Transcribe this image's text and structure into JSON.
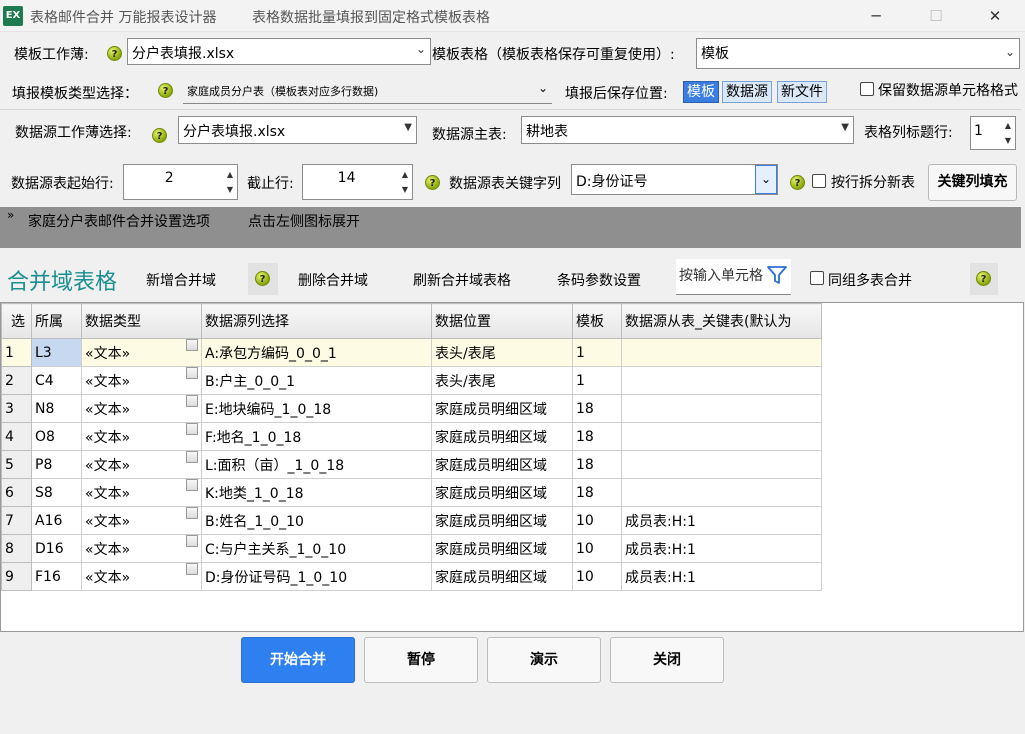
{
  "window": {
    "app_icon": "EX",
    "title": "表格邮件合并 万能报表设计器",
    "subtitle": "表格数据批量填报到固定格式模板表格",
    "minimize": "─",
    "maximize": "☐",
    "close": "✕"
  },
  "row1": {
    "template_workbook_label": "模板工作薄:",
    "template_workbook_value": "分户表填报.xlsx",
    "template_sheet_label": "模板表格（模板表格保存可重复使用）:",
    "template_sheet_value": "模板"
  },
  "row2": {
    "fill_type_label": "填报模板类型选择：",
    "fill_type_value": "家庭成员分户表（模板表对应多行数据)",
    "save_location_label": "填报后保存位置:",
    "save_options": [
      "模板",
      "数据源",
      "新文件"
    ],
    "keep_format_label": "保留数据源单元格格式"
  },
  "row3": {
    "source_workbook_label": "数据源工作薄选择:",
    "source_workbook_value": "分户表填报.xlsx",
    "source_main_label": "数据源主表:",
    "source_main_value": "耕地表",
    "header_row_label": "表格列标题行:",
    "header_row_value": "1"
  },
  "row4": {
    "start_row_label": "数据源表起始行:",
    "start_row_value": "2",
    "end_row_label": "截止行:",
    "end_row_value": "14",
    "key_column_label": "数据源表关键字列",
    "key_column_value": "D:身份证号",
    "split_label": "按行拆分新表",
    "key_fill_button": "关键列填充"
  },
  "strip": {
    "expand_icon": "»",
    "title": "家庭分户表邮件合并设置选项",
    "hint": "点击左侧图标展开"
  },
  "toolbar": {
    "section_title": "合并域表格",
    "add": "新增合并域",
    "delete": "删除合并域",
    "refresh": "刷新合并域表格",
    "barcode": "条码参数设置",
    "search_placeholder": "按输入单元格",
    "group_label": "同组多表合并"
  },
  "grid": {
    "headers": [
      "选",
      "所属",
      "数据类型",
      "数据源列选择",
      "数据位置",
      "模板",
      "数据源从表_关键表(默认为"
    ],
    "rows": [
      [
        "1",
        "L3",
        "«文本»",
        "A:承包方编码_0_0_1",
        "表头/表尾",
        "1",
        ""
      ],
      [
        "2",
        "C4",
        "«文本»",
        "B:户主_0_0_1",
        "表头/表尾",
        "1",
        ""
      ],
      [
        "3",
        "N8",
        "«文本»",
        "E:地块编码_1_0_18",
        "家庭成员明细区域",
        "18",
        ""
      ],
      [
        "4",
        "O8",
        "«文本»",
        "F:地名_1_0_18",
        "家庭成员明细区域",
        "18",
        ""
      ],
      [
        "5",
        "P8",
        "«文本»",
        "L:面积（亩）_1_0_18",
        "家庭成员明细区域",
        "18",
        ""
      ],
      [
        "6",
        "S8",
        "«文本»",
        "K:地类_1_0_18",
        "家庭成员明细区域",
        "18",
        ""
      ],
      [
        "7",
        "A16",
        "«文本»",
        "B:姓名_1_0_10",
        "家庭成员明细区域",
        "10",
        "成员表:H:1"
      ],
      [
        "8",
        "D16",
        "«文本»",
        "C:与户主关系_1_0_10",
        "家庭成员明细区域",
        "10",
        "成员表:H:1"
      ],
      [
        "9",
        "F16",
        "«文本»",
        "D:身份证号码_1_0_10",
        "家庭成员明细区域",
        "10",
        "成员表:H:1"
      ]
    ]
  },
  "bottom": {
    "start": "开始合并",
    "pause": "暂停",
    "demo": "演示",
    "close": "关闭"
  },
  "colors": {
    "primary": "#2e80f0",
    "section_title": "#1a8f8f",
    "strip": "#8f8f8f"
  }
}
